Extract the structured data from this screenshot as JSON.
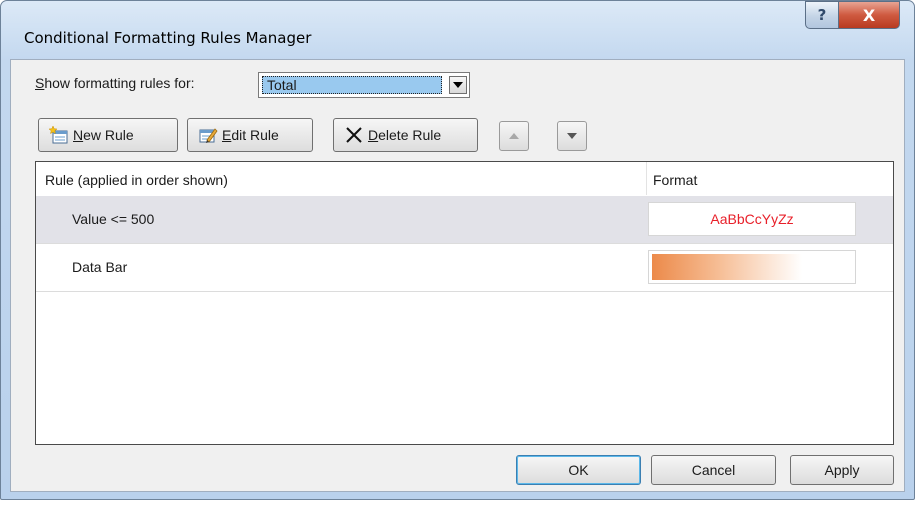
{
  "window": {
    "title": "Conditional Formatting Rules Manager",
    "help_glyph": "?",
    "close_glyph": "X"
  },
  "show_rules": {
    "label_prefix": "S",
    "label_rest": "how formatting rules for:",
    "selected_value": "Total"
  },
  "toolbar": {
    "new_rule_u": "N",
    "new_rule_rest": "ew Rule",
    "edit_rule_u": "E",
    "edit_rule_rest": "dit Rule",
    "delete_rule_u": "D",
    "delete_rule_rest": "elete Rule"
  },
  "list": {
    "header_rule": "Rule (applied in order shown)",
    "header_format": "Format",
    "rows": [
      {
        "label": "Value <= 500",
        "format_sample": "AaBbCcYyZz",
        "selected": true
      },
      {
        "label": "Data Bar",
        "format_type": "data-bar",
        "selected": false
      }
    ]
  },
  "footer": {
    "ok": "OK",
    "cancel": "Cancel",
    "apply": "Apply"
  },
  "colors": {
    "selection": "#99c9ef",
    "format_text": "#e8202a",
    "databar": "#ec8a4a"
  }
}
